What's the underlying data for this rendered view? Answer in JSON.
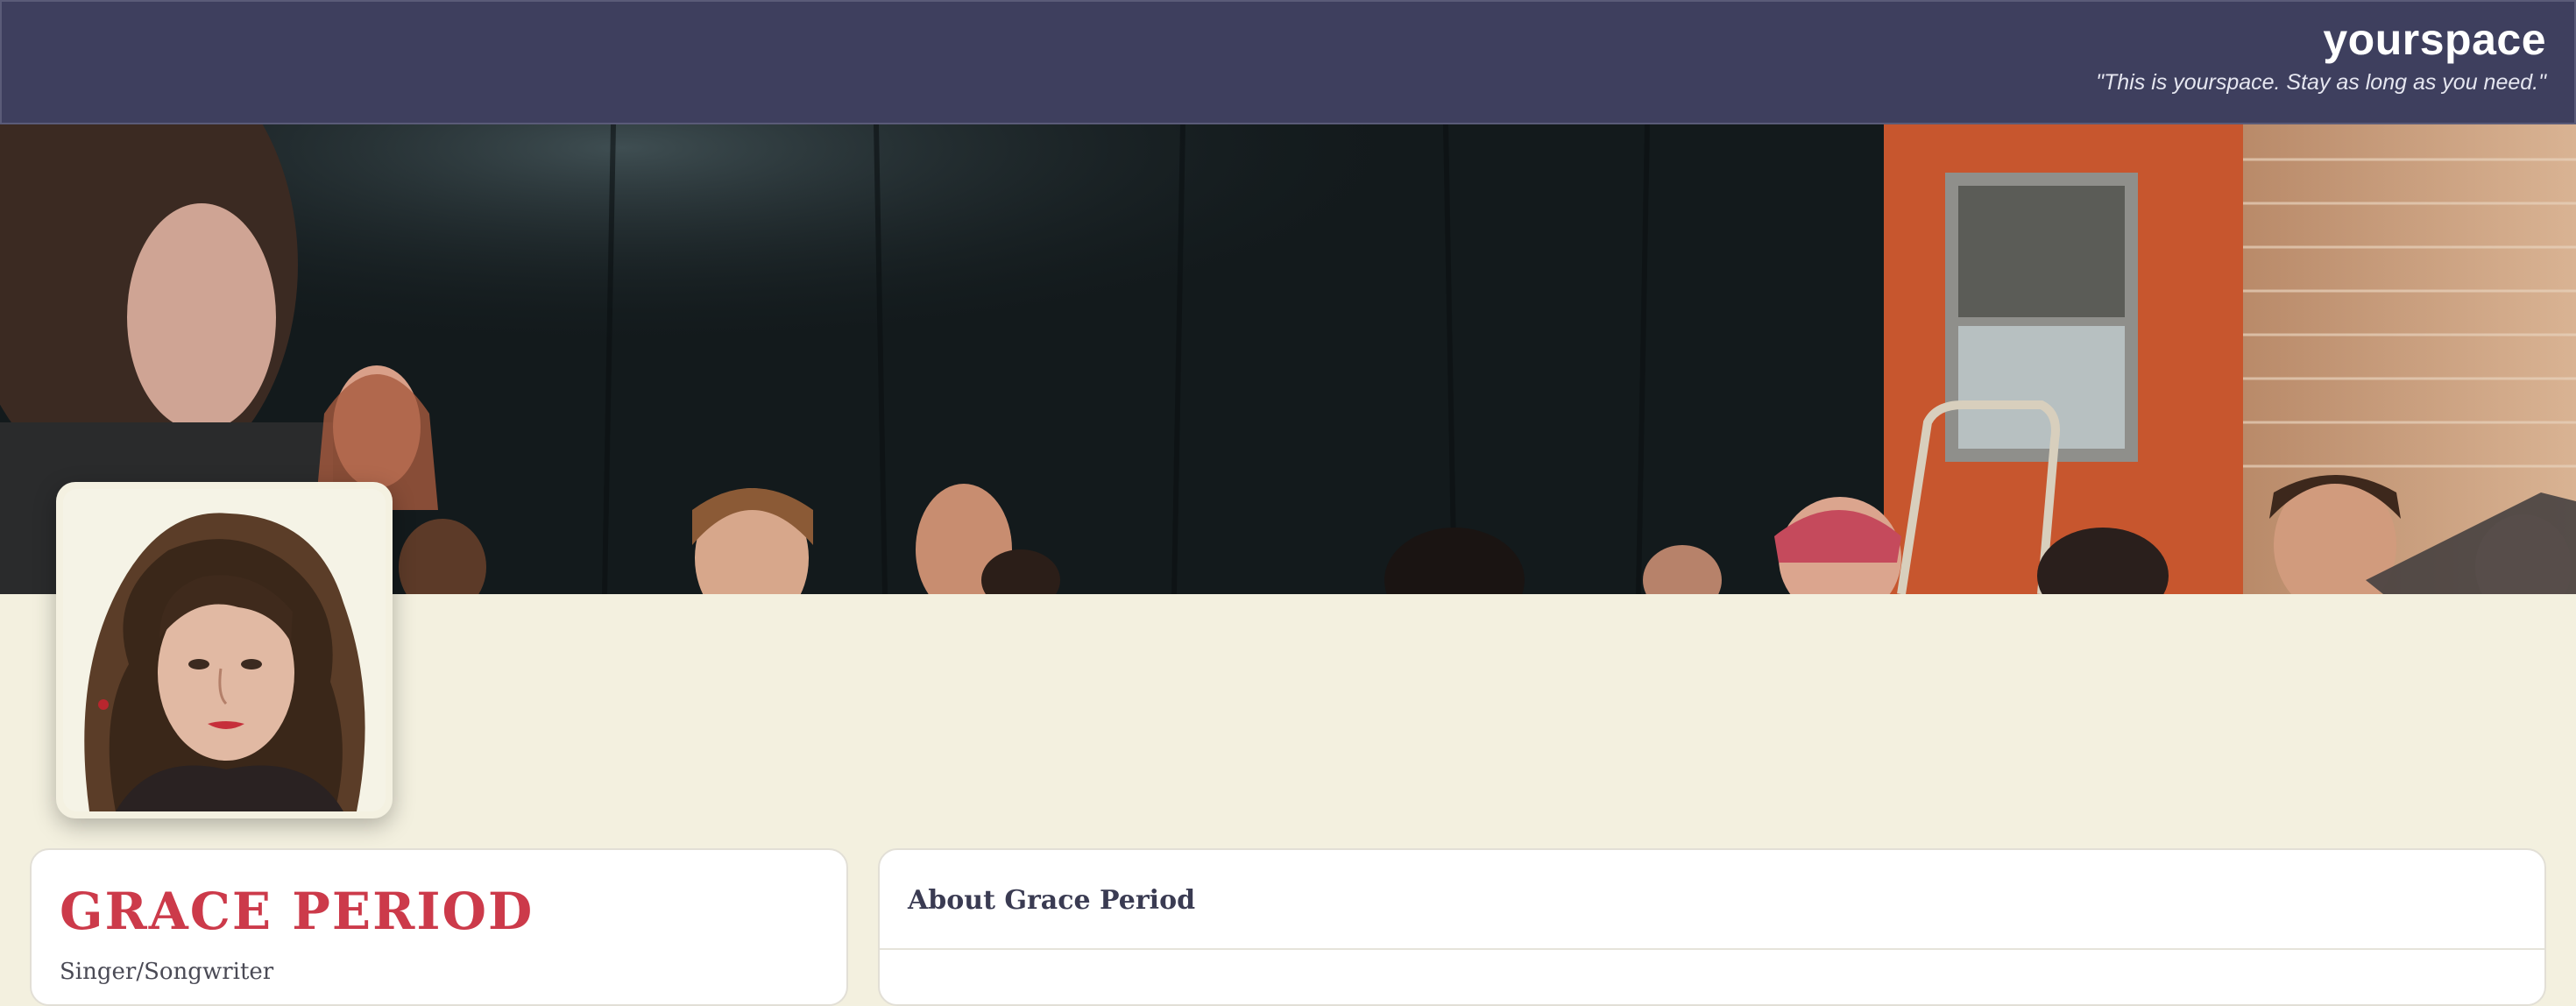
{
  "header": {
    "brand": "yourspace",
    "tagline": "\"This is yourspace. Stay as long as you need.\""
  },
  "profile": {
    "name": "GRACE PERIOD",
    "role": "Singer/Songwriter"
  },
  "about": {
    "title": "About Grace Period"
  },
  "colors": {
    "header_bg": "#3e3f5e",
    "page_bg": "#f3f0df",
    "accent_name": "#cc3a4a",
    "card_bg": "#ffffff"
  }
}
